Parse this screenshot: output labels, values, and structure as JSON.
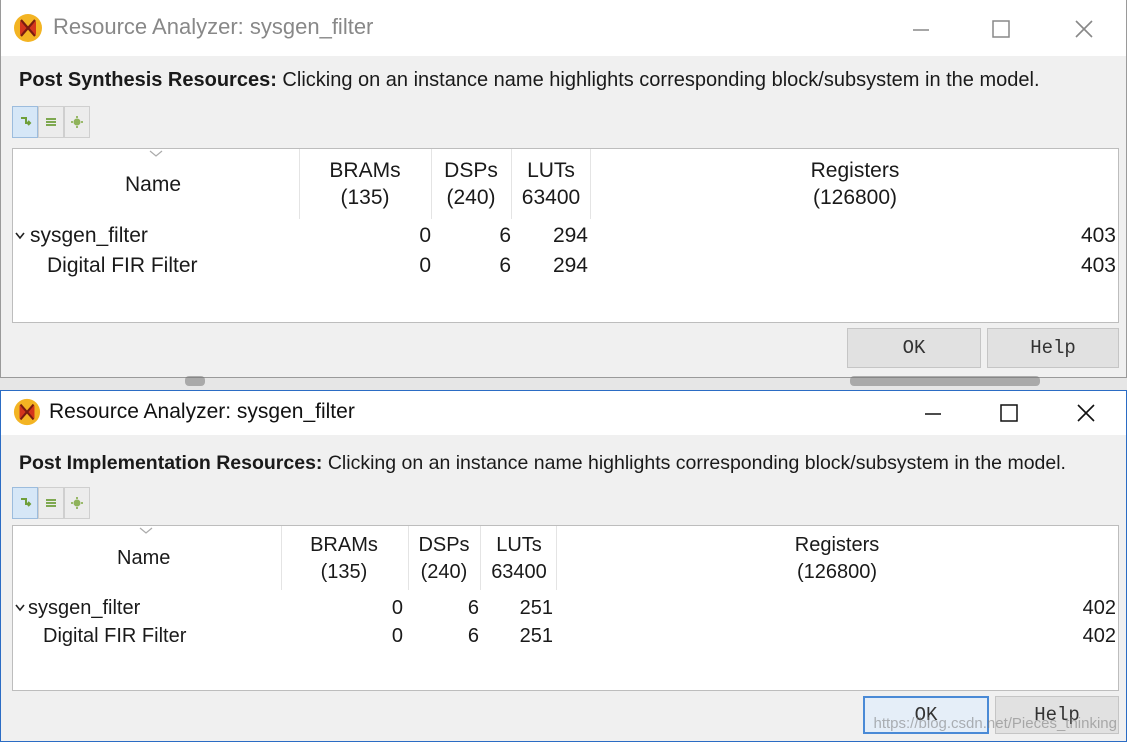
{
  "windows": [
    {
      "title": "Resource Analyzer: sysgen_filter",
      "header_bold": "Post Synthesis Resources:",
      "header_text": " Clicking on an instance name highlights corresponding block/subsystem in the model.",
      "columns": [
        {
          "line1": "Name",
          "line2": ""
        },
        {
          "line1": "BRAMs",
          "line2": "(135)"
        },
        {
          "line1": "DSPs",
          "line2": "(240)"
        },
        {
          "line1": "LUTs",
          "line2": "63400"
        },
        {
          "line1": "Registers",
          "line2": "(126800)"
        }
      ],
      "rows": [
        {
          "name": "sysgen_filter",
          "expanded": true,
          "brams": "0",
          "dsps": "6",
          "luts": "294",
          "registers": "403"
        },
        {
          "name": "Digital FIR Filter",
          "expanded": false,
          "brams": "0",
          "dsps": "6",
          "luts": "294",
          "registers": "403"
        }
      ],
      "ok_label": "OK",
      "help_label": "Help"
    },
    {
      "title": "Resource Analyzer: sysgen_filter",
      "header_bold": "Post Implementation Resources:",
      "header_text": " Clicking on an instance name highlights corresponding block/subsystem in the model.",
      "columns": [
        {
          "line1": "Name",
          "line2": ""
        },
        {
          "line1": "BRAMs",
          "line2": "(135)"
        },
        {
          "line1": "DSPs",
          "line2": "(240)"
        },
        {
          "line1": "LUTs",
          "line2": "63400"
        },
        {
          "line1": "Registers",
          "line2": "(126800)"
        }
      ],
      "rows": [
        {
          "name": "sysgen_filter",
          "expanded": true,
          "brams": "0",
          "dsps": "6",
          "luts": "251",
          "registers": "402"
        },
        {
          "name": "Digital FIR Filter",
          "expanded": false,
          "brams": "0",
          "dsps": "6",
          "luts": "251",
          "registers": "402"
        }
      ],
      "ok_label": "OK",
      "help_label": "Help"
    }
  ],
  "icons": {
    "app": "xilinx-sysgen-icon",
    "minimize": "minimize-icon",
    "maximize": "maximize-icon",
    "close": "close-icon",
    "toolbar": [
      "expand-icon",
      "collapse-icon",
      "settings-icon"
    ]
  },
  "colors": {
    "window_bg": "#f0f0f0",
    "active_border": "#2b6cc4",
    "default_button_border": "#4a8ad6"
  },
  "watermark": "https://blog.csdn.net/Pieces_thinking"
}
